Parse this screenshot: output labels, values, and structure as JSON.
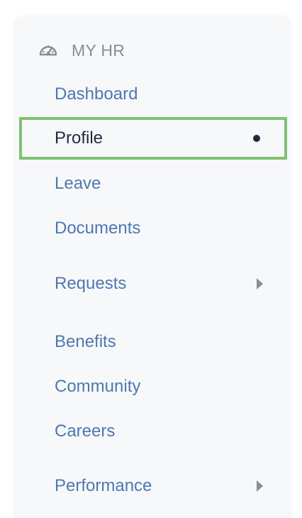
{
  "sidebar": {
    "section": {
      "icon": "dashboard-gauge-icon",
      "title": "MY HR"
    },
    "items": [
      {
        "label": "Dashboard"
      },
      {
        "label": "Profile",
        "active": true
      },
      {
        "label": "Leave"
      },
      {
        "label": "Documents"
      },
      {
        "label": "Requests",
        "has_submenu": true
      },
      {
        "label": "Benefits"
      },
      {
        "label": "Community"
      },
      {
        "label": "Careers"
      },
      {
        "label": "Performance",
        "has_submenu": true
      }
    ]
  },
  "colors": {
    "panel_bg": "#f7f8fa",
    "link": "#4e78b0",
    "active_text": "#1f2b3d",
    "highlight_border": "#7fc16f",
    "muted": "#8a8d93"
  }
}
